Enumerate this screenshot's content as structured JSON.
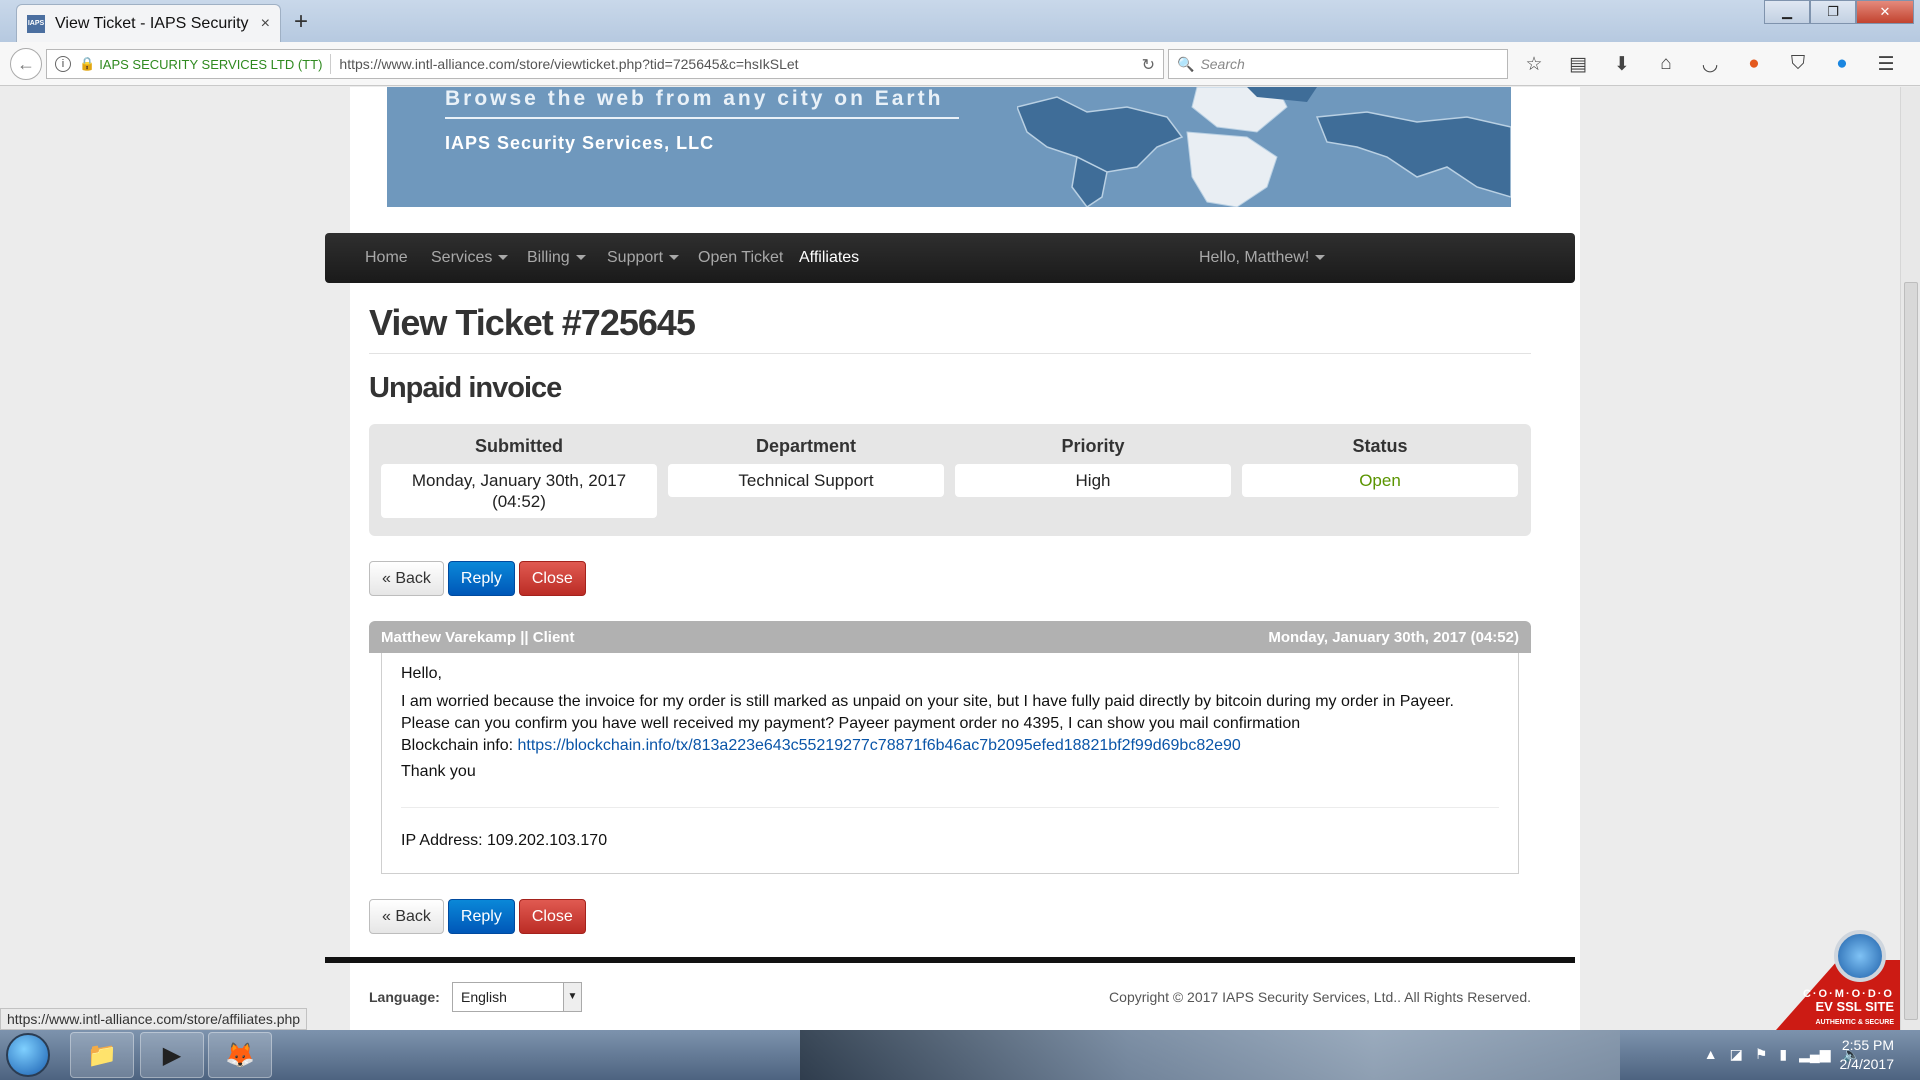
{
  "browser": {
    "tab_title": "View Ticket - IAPS Security ...",
    "tab_favicon_text": "IAPS",
    "tab_close": "×",
    "new_tab": "+",
    "win_min": "▁",
    "win_max": "❐",
    "win_close": "✕",
    "identity": "IAPS SECURITY SERVICES LTD (TT)",
    "url": "https://www.intl-alliance.com/store/viewticket.php?tid=725645&c=hsIkSLet",
    "search_placeholder": "Search",
    "toolbar_icons": [
      "star-icon",
      "reading-list-icon",
      "download-icon",
      "home-icon",
      "pocket-icon",
      "duckduckgo-icon",
      "ublock-icon",
      "share-icon",
      "menu-icon"
    ],
    "status_url": "https://www.intl-alliance.com/store/affiliates.php"
  },
  "banner": {
    "tagline": "Browse the web from any city on Earth",
    "company": "IAPS Security Services, LLC"
  },
  "nav": {
    "home": "Home",
    "services": "Services",
    "billing": "Billing",
    "support": "Support",
    "open_ticket": "Open Ticket",
    "affiliates": "Affiliates",
    "user": "Hello, Matthew!"
  },
  "ticket": {
    "title": "View Ticket #725645",
    "subject": "Unpaid invoice",
    "submitted_label": "Submitted",
    "submitted_value": "Monday, January 30th, 2017 (04:52)",
    "department_label": "Department",
    "department_value": "Technical Support",
    "priority_label": "Priority",
    "priority_value": "High",
    "status_label": "Status",
    "status_value": "Open",
    "status_color": "#5a9400"
  },
  "buttons": {
    "back": "« Back",
    "reply": "Reply",
    "close": "Close"
  },
  "message": {
    "author": "Matthew Varekamp || Client",
    "date": "Monday, January 30th, 2017 (04:52)",
    "greeting": "Hello,",
    "line1": "I am worried because the invoice for my order is still marked as unpaid on your site, but I have fully paid directly by bitcoin during my order in Payeer.",
    "line2": "Please can you confirm you have well received my payment? Payeer payment order no 4395, I can show you mail confirmation",
    "blockchain_label": "Blockchain info: ",
    "blockchain_link": "https://blockchain.info/tx/813a223e643c55219277c78871f6b46ac7b2095efed18821bf2f99d69bc82e90",
    "thanks": "Thank you",
    "ip": "IP Address: 109.202.103.170"
  },
  "footer": {
    "language_label": "Language:",
    "language_value": "English",
    "copyright": "Copyright © 2017 IAPS Security Services, Ltd.. All Rights Reserved."
  },
  "comodo": {
    "line1": "C·O·M·O·D·O",
    "line2": "EV SSL SITE",
    "line3": "AUTHENTIC & SECURE"
  },
  "taskbar": {
    "time": "2:55 PM",
    "date": "2/4/2017"
  }
}
